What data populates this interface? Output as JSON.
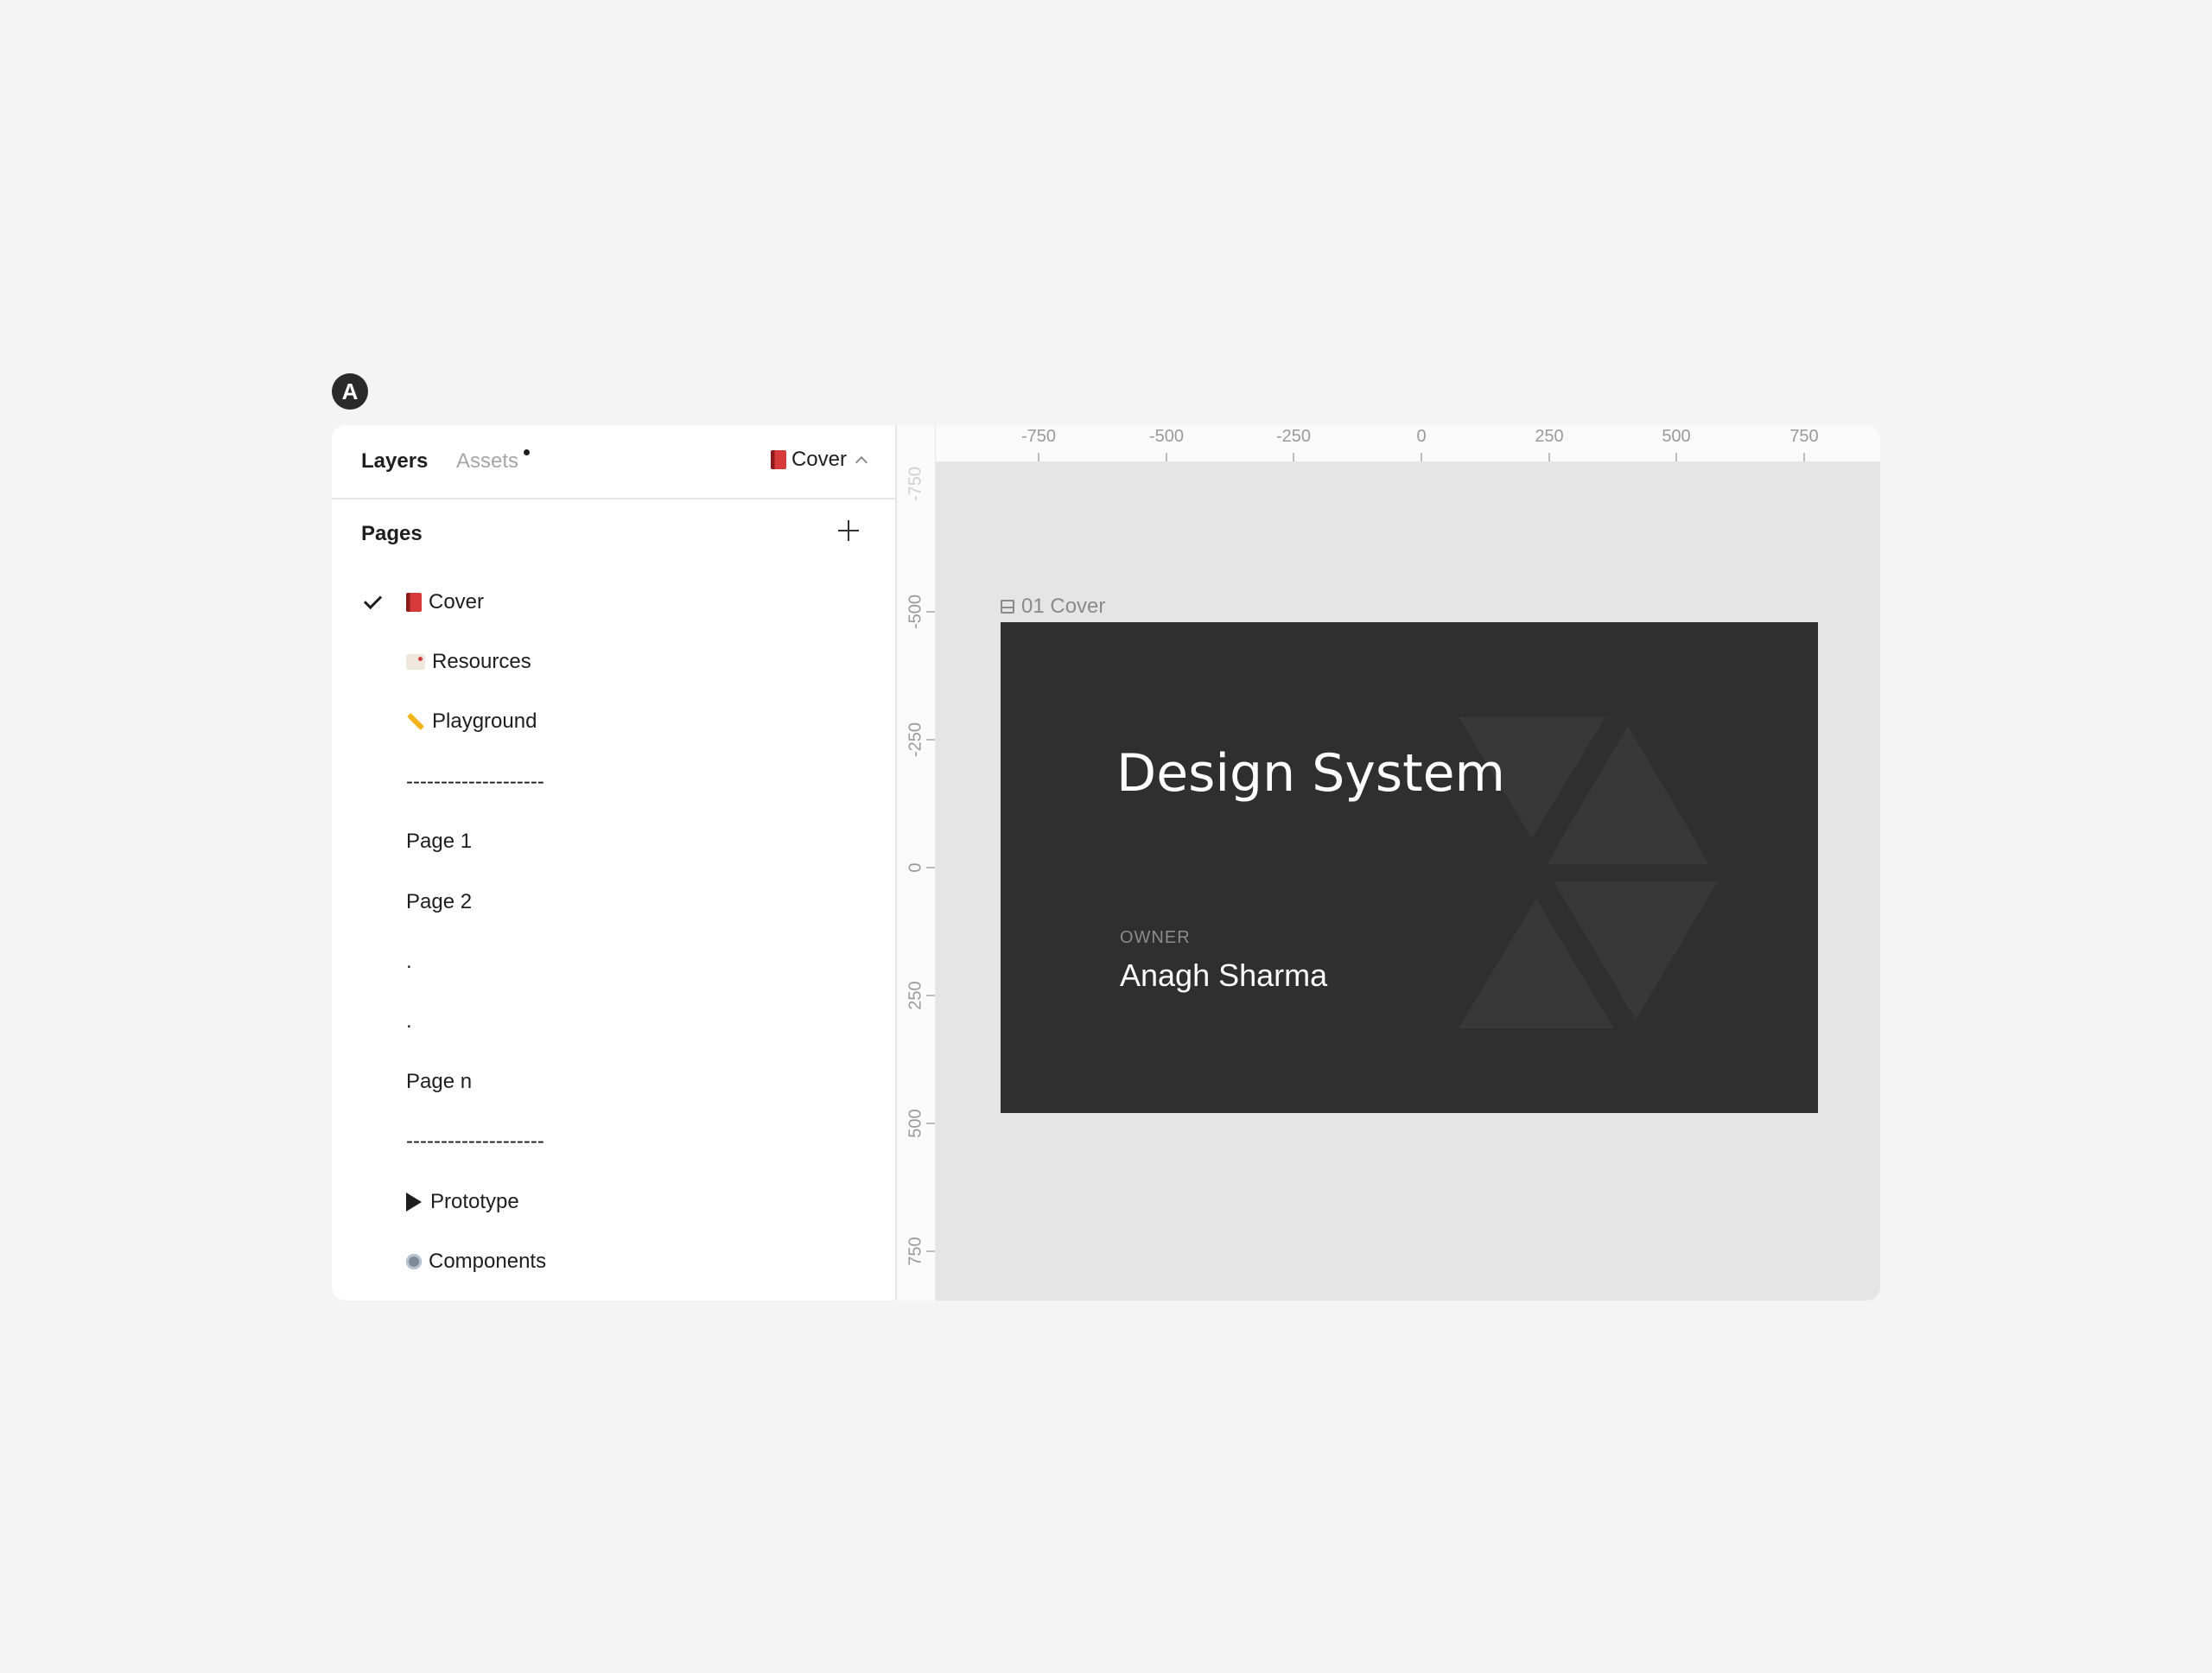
{
  "badge": {
    "letter": "A"
  },
  "header": {
    "tabs": [
      {
        "label": "Layers",
        "active": true
      },
      {
        "label": "Assets",
        "active": false,
        "has_dot": true
      }
    ],
    "current_page": {
      "emoji": "book-icon",
      "label": "Cover"
    }
  },
  "pages": {
    "title": "Pages",
    "add_icon": "plus-icon",
    "items": [
      {
        "label": "Cover",
        "icon": "book-icon",
        "selected": true
      },
      {
        "label": "Resources",
        "icon": "tag-icon"
      },
      {
        "label": "Playground",
        "icon": "pencil-icon"
      },
      {
        "label": "--------------------",
        "icon": ""
      },
      {
        "label": "Page 1",
        "icon": ""
      },
      {
        "label": "Page 2",
        "icon": ""
      },
      {
        "label": ".",
        "icon": ""
      },
      {
        "label": ".",
        "icon": ""
      },
      {
        "label": "Page n",
        "icon": ""
      },
      {
        "label": "--------------------",
        "icon": ""
      },
      {
        "label": "Prototype",
        "icon": "play-icon"
      },
      {
        "label": "Components",
        "icon": "gear-icon"
      }
    ]
  },
  "rulers": {
    "top": [
      "-750",
      "-500",
      "-250",
      "0",
      "250",
      "500",
      "750"
    ],
    "left": [
      "-750",
      "-500",
      "-250",
      "0",
      "250",
      "500",
      "750"
    ]
  },
  "frame": {
    "label": "01 Cover",
    "title": "Design System",
    "owner_label": "OWNER",
    "owner_name": "Anagh Sharma"
  },
  "colors": {
    "canvas_bg": "#e5e5e5",
    "frame_bg": "#2f2f2f",
    "page_bg": "#f4f4f4"
  }
}
